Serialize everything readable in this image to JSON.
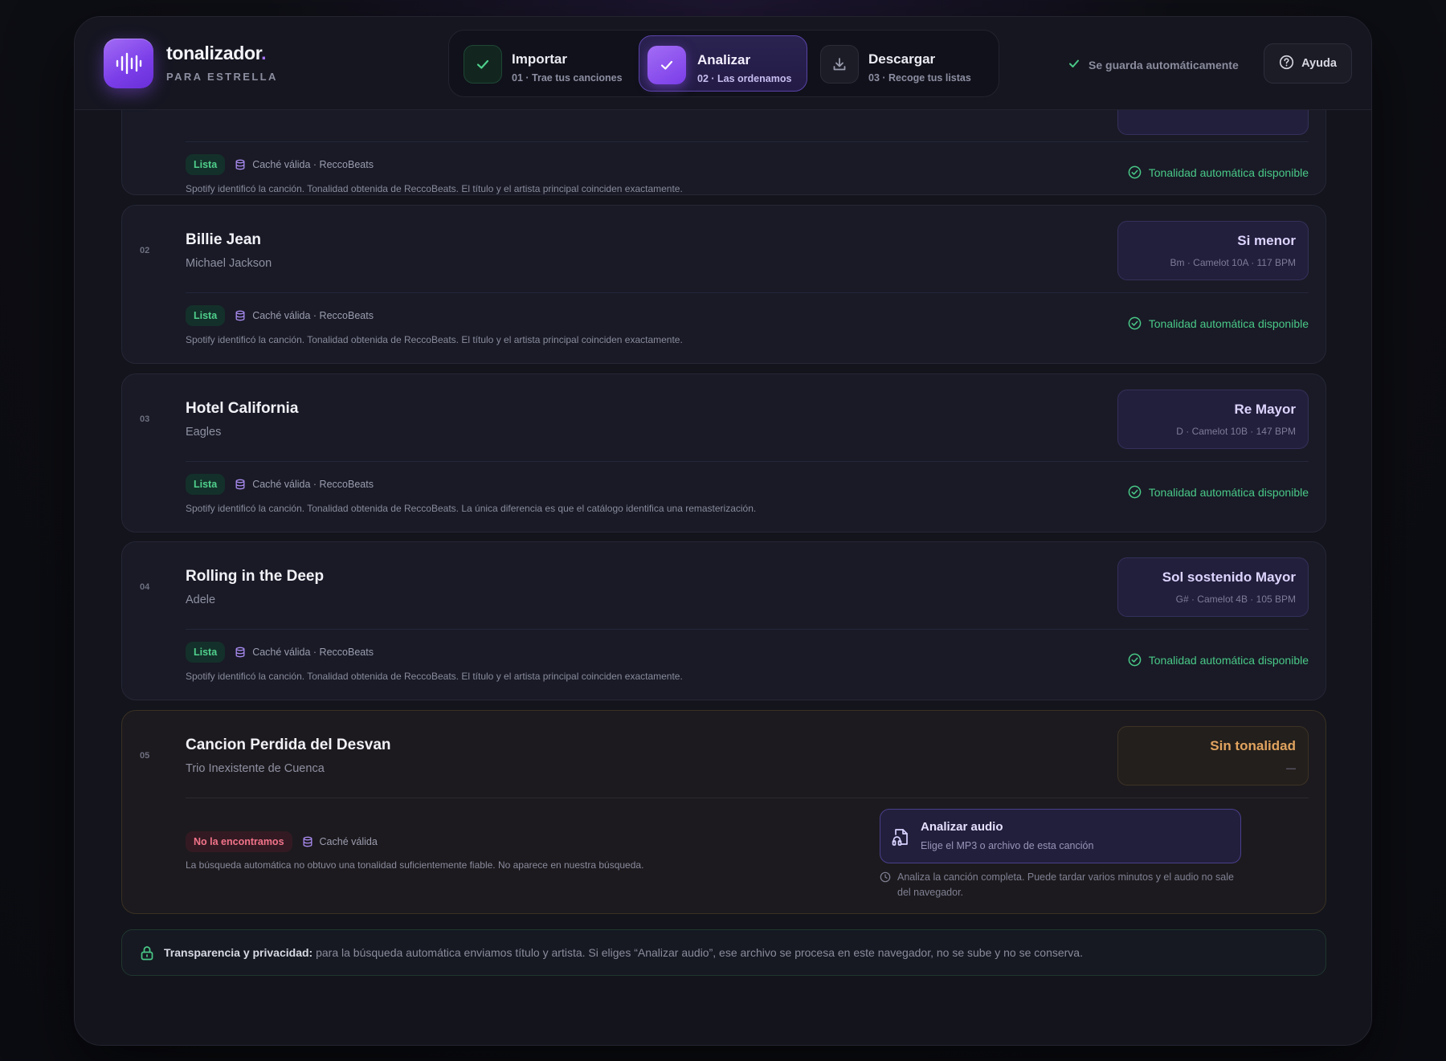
{
  "brand": {
    "name": "tonalizador",
    "dot": ".",
    "subtitle": "PARA ESTRELLA"
  },
  "steps": [
    {
      "title": "Importar",
      "sub": "01 · Trae tus canciones",
      "state": "done"
    },
    {
      "title": "Analizar",
      "sub": "02 · Las ordenamos",
      "state": "active"
    },
    {
      "title": "Descargar",
      "sub": "03 · Recoge tus listas",
      "state": "pending"
    }
  ],
  "autosave": "Se guarda automáticamente",
  "help": "Ayuda",
  "songs": [
    {
      "num": "",
      "badge": "Lista",
      "cache": "Caché válida · ReccoBeats",
      "note": "Spotify identificó la canción. Tonalidad obtenida de ReccoBeats. El título y el artista principal coinciden exactamente.",
      "status": "Tonalidad automática disponible"
    },
    {
      "num": "02",
      "title": "Billie Jean",
      "artist": "Michael Jackson",
      "key": "Si menor",
      "meta": "Bm · Camelot 10A · 117 BPM",
      "badge": "Lista",
      "cache": "Caché válida · ReccoBeats",
      "note": "Spotify identificó la canción. Tonalidad obtenida de ReccoBeats. El título y el artista principal coinciden exactamente.",
      "status": "Tonalidad automática disponible"
    },
    {
      "num": "03",
      "title": "Hotel California",
      "artist": "Eagles",
      "key": "Re Mayor",
      "meta": "D · Camelot 10B · 147 BPM",
      "badge": "Lista",
      "cache": "Caché válida · ReccoBeats",
      "note": "Spotify identificó la canción. Tonalidad obtenida de ReccoBeats. La única diferencia es que el catálogo identifica una remasterización.",
      "status": "Tonalidad automática disponible"
    },
    {
      "num": "04",
      "title": "Rolling in the Deep",
      "artist": "Adele",
      "key": "Sol sostenido Mayor",
      "meta": "G# · Camelot 4B · 105 BPM",
      "badge": "Lista",
      "cache": "Caché válida · ReccoBeats",
      "note": "Spotify identificó la canción. Tonalidad obtenida de ReccoBeats. El título y el artista principal coinciden exactamente.",
      "status": "Tonalidad automática disponible"
    },
    {
      "num": "05",
      "title": "Cancion Perdida del Desvan",
      "artist": "Trio Inexistente de Cuenca",
      "key": "Sin tonalidad",
      "meta": "—",
      "badge": "No la encontramos",
      "cache": "Caché válida",
      "note": "La búsqueda automática no obtuvo una tonalidad suficientemente fiable. No aparece en nuestra búsqueda.",
      "audio_title": "Analizar audio",
      "audio_sub": "Elige el MP3 o archivo de esta canción",
      "audio_note": "Analiza la canción completa. Puede tardar varios minutos y el audio no sale del navegador."
    }
  ],
  "privacy": {
    "label": "Transparencia y privacidad:",
    "text": "para la búsqueda automática enviamos título y artista. Si eliges “Analizar audio”, ese archivo se procesa en este navegador, no se sube y no se conserva."
  },
  "colors": {
    "accent": "#8b4cf0",
    "ok": "#49c887",
    "warn": "#e0a35f",
    "error": "#f2738a"
  }
}
